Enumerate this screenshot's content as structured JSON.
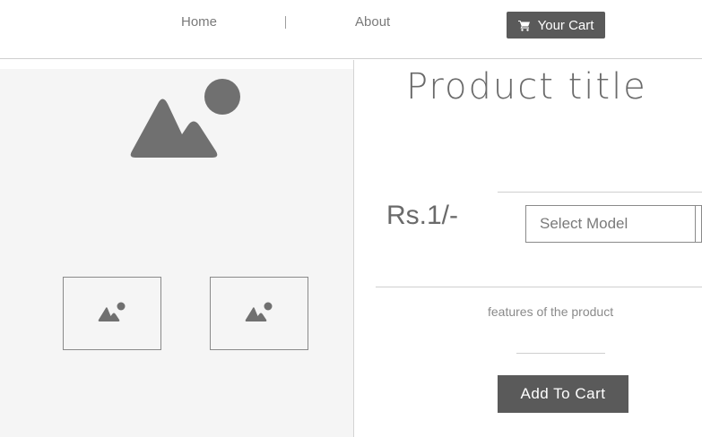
{
  "nav": {
    "home_label": "Home",
    "about_label": "About",
    "cart_label": "Your Cart",
    "cart_icon": "shopping-cart-icon"
  },
  "gallery": {
    "main_image_icon": "image-placeholder-icon",
    "thumbnails": [
      {
        "icon": "image-placeholder-icon"
      },
      {
        "icon": "image-placeholder-icon"
      }
    ]
  },
  "product": {
    "title": "Product title",
    "price": "Rs.1/-",
    "select_model_placeholder": "Select Model",
    "features_text": "features of the product",
    "add_to_cart_label": "Add To Cart"
  },
  "colors": {
    "button_bg": "#5a5a5a",
    "gallery_bg": "#f5f5f5",
    "icon_fill": "#707070"
  }
}
